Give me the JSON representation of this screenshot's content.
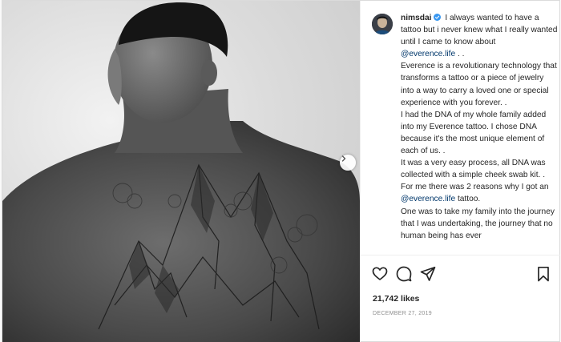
{
  "post": {
    "username": "nimsdai",
    "caption_lines": [
      "I always wanted to have a tattoo but i never knew what I really wanted until I came to know about"
    ],
    "mention_1": "@everence.life",
    "mention_1_suffix": " . .",
    "para_2": "Everence is a revolutionary technology that transforms a tattoo or a piece of jewelry into a way to carry a loved one or special experience with you forever. .",
    "para_3": "I had the DNA of my whole family added into my Everence tattoo. I chose DNA because it's the most unique element of each of us. .",
    "para_4": "It was a very easy process, all DNA was collected with a simple cheek swab kit. .",
    "para_5_prefix": "For me there was 2 reasons why I got an ",
    "mention_2": "@everence.life",
    "para_5_suffix": " tattoo.",
    "para_6": "One was to take my family into the journey that I was undertaking, the journey that no human being has ever",
    "likes": "21,742 likes",
    "date": "DECEMBER 27, 2019"
  },
  "icons": {
    "verified": "verified-badge-icon",
    "like": "heart-icon",
    "comment": "comment-icon",
    "share": "share-icon",
    "save": "bookmark-icon",
    "next": "chevron-right-icon"
  },
  "colors": {
    "verified": "#3897f0",
    "mention": "#00376b",
    "muted": "#8e8e8e"
  }
}
